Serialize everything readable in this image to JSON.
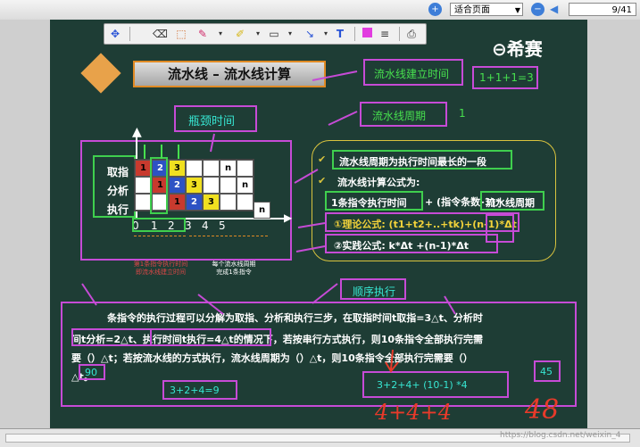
{
  "viewer": {
    "zoom_select": "适合页面",
    "page_indicator": "9/41",
    "watermark": "https://blog.csdn.net/weixin_4"
  },
  "slide": {
    "title": "流水线 – 流水线计算",
    "logo": "希赛",
    "labels": {
      "bottleneck": "瓶颈时间",
      "build_time": "流水线建立时间",
      "build_eq": "1+1+1=3",
      "period": "流水线周期",
      "period_val": "1",
      "seq_exec": "顺序执行"
    },
    "diagram": {
      "row_labels": [
        "取指",
        "分析",
        "执行"
      ],
      "positions": [
        "0",
        "1",
        "2",
        "3",
        "4",
        "5"
      ],
      "rows": [
        [
          {
            "t": "1",
            "c": "red"
          },
          {
            "t": "2",
            "c": "blue"
          },
          {
            "t": "3",
            "c": "yel"
          },
          {
            "t": "",
            "c": ""
          },
          {
            "t": "",
            "c": ""
          },
          {
            "t": "n",
            "c": ""
          },
          {
            "t": "",
            "c": ""
          }
        ],
        [
          {
            "t": "",
            "c": ""
          },
          {
            "t": "1",
            "c": "red"
          },
          {
            "t": "2",
            "c": "blue"
          },
          {
            "t": "3",
            "c": "yel"
          },
          {
            "t": "",
            "c": ""
          },
          {
            "t": "",
            "c": ""
          },
          {
            "t": "n",
            "c": ""
          }
        ],
        [
          {
            "t": "",
            "c": ""
          },
          {
            "t": "",
            "c": ""
          },
          {
            "t": "1",
            "c": "red"
          },
          {
            "t": "2",
            "c": "blue"
          },
          {
            "t": "3",
            "c": "yel"
          },
          {
            "t": "",
            "c": ""
          },
          {
            "t": "",
            "c": ""
          }
        ]
      ],
      "n_extra": "n",
      "note_left": "第1条指令执行时间\n即流水线建立时间",
      "note_right": "每个流水线周期\n完成1条指令"
    },
    "bullets": {
      "b1": "流水线周期为执行时间最长的一段",
      "b2": "流水线计算公式为:",
      "b3_a": "1条指令执行时间",
      "b3_b": "+ (指令条数-1)*",
      "b3_c": "流水线周期",
      "f1": "①理论公式: (t1+t2+..+tk)+(n-1)*Δt",
      "f2": "②实践公式: k*Δt +(n-1)*Δt"
    },
    "question": {
      "line1": "条指令的执行过程可以分解为取指、分析和执行三步，在取指时间t取指=3△t、分析时",
      "line2": "间t分析=2△t、执行时间t执行=4△t的情况下，若按串行方式执行，则10条指令全部执行完需",
      "line3": "要（）△t；若按流水线的方式执行，流水线周期为（）△t，则10条指令全部执行完需要（）",
      "line4": "△t。",
      "ans_90": "90",
      "ans_eq1": "3+2+4=9",
      "ans_eq2": "3+2+4+ (10-1) *4",
      "ans_45": "45",
      "hand_1": "4+4+4",
      "hand_2": "48"
    },
    "colors": {
      "board": "#1e3d35",
      "magenta": "#c64bd6",
      "green": "#3fcf4e",
      "cyan": "#37e6d2",
      "orange": "#e08a24",
      "red_ink": "#e83a2a"
    }
  }
}
